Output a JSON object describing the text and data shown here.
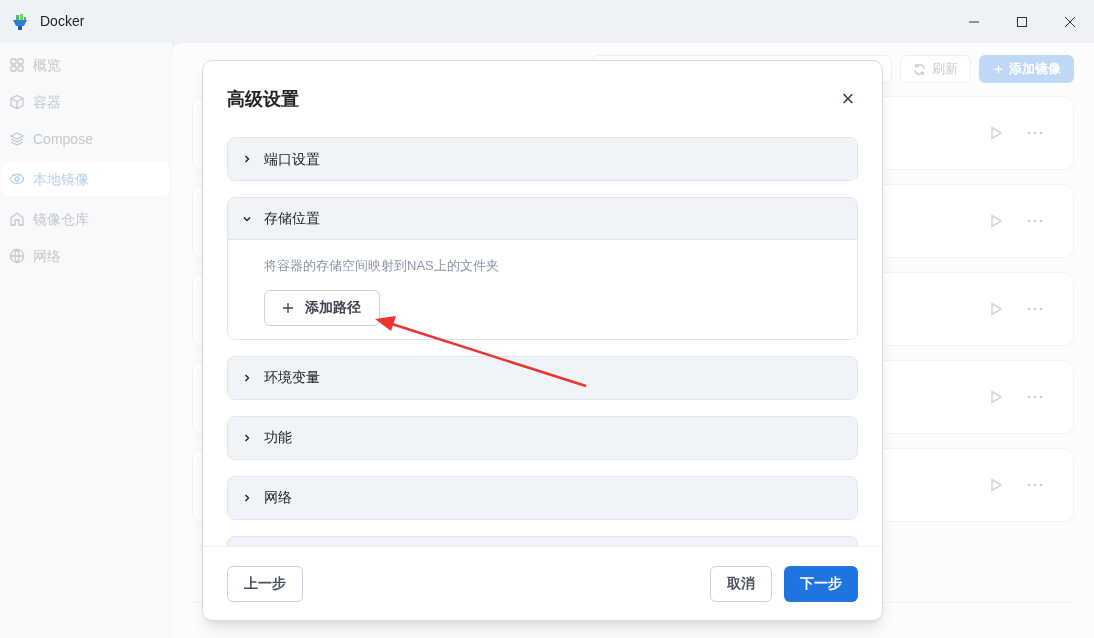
{
  "window": {
    "title": "Docker"
  },
  "sidebar": {
    "items": [
      {
        "label": "概览",
        "selected": false
      },
      {
        "label": "容器",
        "selected": false
      },
      {
        "label": "Compose",
        "selected": false
      },
      {
        "label": "本地镜像",
        "selected": true
      },
      {
        "label": "镜像仓库",
        "selected": false
      },
      {
        "label": "网络",
        "selected": false
      }
    ]
  },
  "main": {
    "refresh_button": "刷新",
    "add_button": "＋ 添加镜像"
  },
  "dialog": {
    "title": "高级设置",
    "close": "×",
    "sections": [
      {
        "title": "端口设置",
        "expanded": false
      },
      {
        "title": "存储位置",
        "expanded": true,
        "description": "将容器的存储空间映射到NAS上的文件夹",
        "button": "添加路径"
      },
      {
        "title": "环境变量",
        "expanded": false
      },
      {
        "title": "功能",
        "expanded": false
      },
      {
        "title": "网络",
        "expanded": false
      }
    ],
    "prev_button": "上一步",
    "cancel_button": "取消",
    "next_button": "下一步"
  }
}
